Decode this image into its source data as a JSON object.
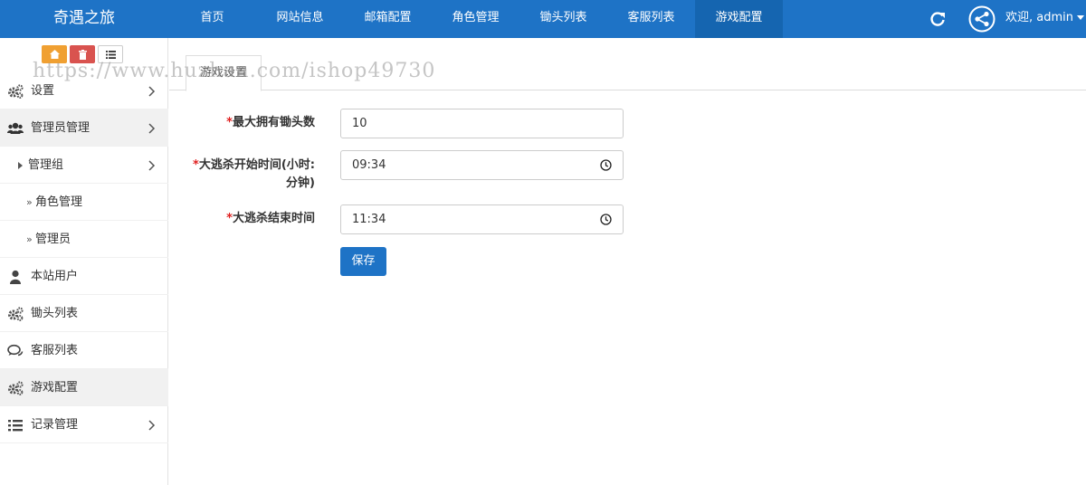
{
  "header": {
    "brand": "奇遇之旅",
    "nav": [
      {
        "label": "首页",
        "active": false
      },
      {
        "label": "网站信息",
        "active": false
      },
      {
        "label": "邮箱配置",
        "active": false
      },
      {
        "label": "角色管理",
        "active": false
      },
      {
        "label": "锄头列表",
        "active": false
      },
      {
        "label": "客服列表",
        "active": false
      },
      {
        "label": "游戏配置",
        "active": true
      }
    ],
    "refresh_icon": "refresh-icon",
    "share_icon": "share-icon",
    "user_label": "欢迎, admin"
  },
  "sidebar": {
    "tools": [
      "home-icon",
      "trash-icon",
      "list-icon"
    ],
    "items": [
      {
        "label": "设置",
        "icon": "gears-icon",
        "chevron": true
      },
      {
        "label": "管理员管理",
        "icon": "users-icon",
        "chevron": true,
        "selected": true
      },
      {
        "label": "管理组",
        "chevron": true,
        "level": 1
      },
      {
        "label": "角色管理",
        "level": 2
      },
      {
        "label": "管理员",
        "level": 2
      },
      {
        "label": "本站用户",
        "icon": "user-icon"
      },
      {
        "label": "锄头列表",
        "icon": "gears-icon"
      },
      {
        "label": "客服列表",
        "icon": "comments-icon"
      },
      {
        "label": "游戏配置",
        "icon": "gears-icon",
        "selected": true
      },
      {
        "label": "记录管理",
        "icon": "list-icon",
        "chevron": true
      }
    ]
  },
  "tab": {
    "label": "游戏设置"
  },
  "watermark": "https://www.huzhan.com/ishop49730",
  "form": {
    "required_mark": "*",
    "fields": [
      {
        "label": "最大拥有锄头数",
        "value": "10"
      },
      {
        "label_line1": "大逃杀开始时间(小时:",
        "label_line2": "分钟)",
        "value": "09:34"
      },
      {
        "label": "大逃杀结束时间",
        "value": "11:34"
      }
    ],
    "save_label": "保存"
  },
  "colors": {
    "primary": "#1e73c6",
    "active_nav": "#1565b0",
    "required": "#e02020",
    "tool_orange": "#f0a032",
    "tool_red": "#d9534f"
  }
}
